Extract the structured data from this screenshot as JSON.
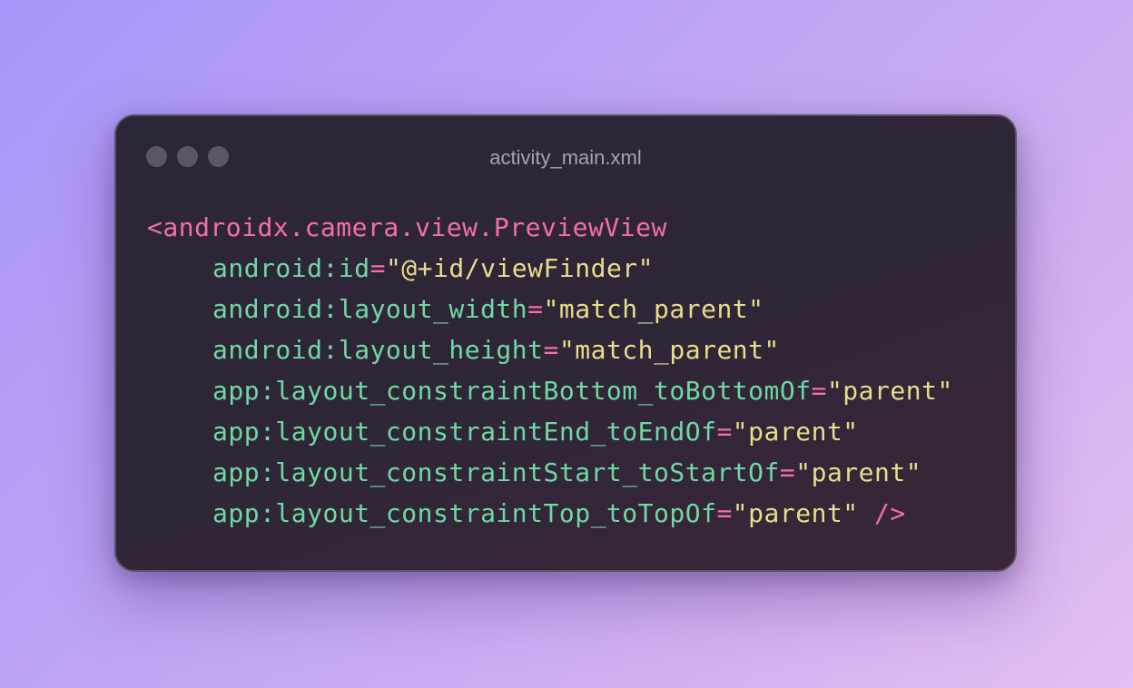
{
  "window": {
    "title": "activity_main.xml"
  },
  "code": {
    "tag_open": "<androidx.camera.view.PreviewView",
    "attributes": [
      {
        "name": "android:id",
        "eq": "=",
        "value": "\"@+id/viewFinder\""
      },
      {
        "name": "android:layout_width",
        "eq": "=",
        "value": "\"match_parent\""
      },
      {
        "name": "android:layout_height",
        "eq": "=",
        "value": "\"match_parent\""
      },
      {
        "name": "app:layout_constraintBottom_toBottomOf",
        "eq": "=",
        "value": "\"parent\""
      },
      {
        "name": "app:layout_constraintEnd_toEndOf",
        "eq": "=",
        "value": "\"parent\""
      },
      {
        "name": "app:layout_constraintStart_toStartOf",
        "eq": "=",
        "value": "\"parent\""
      },
      {
        "name": "app:layout_constraintTop_toTopOf",
        "eq": "=",
        "value": "\"parent\""
      }
    ],
    "tag_close": " />"
  },
  "colors": {
    "tag": "#f46fa9",
    "attribute": "#70d8a3",
    "string": "#e9dd8c",
    "title": "#a7a2b3",
    "window_dot": "#5b5664"
  }
}
